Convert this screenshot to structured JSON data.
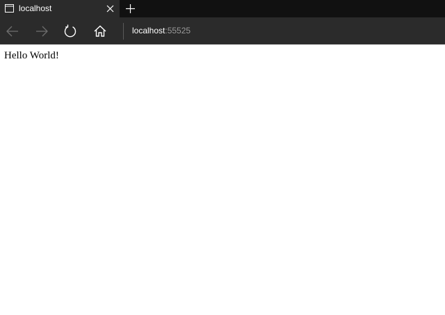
{
  "tab": {
    "title": "localhost",
    "icon": "page-icon"
  },
  "toolbar": {
    "back_icon": "back-arrow-icon",
    "forward_icon": "forward-arrow-icon",
    "refresh_icon": "refresh-icon",
    "home_icon": "home-icon",
    "new_tab_icon": "plus-icon",
    "close_tab_icon": "close-icon"
  },
  "address": {
    "host": "localhost",
    "port": ":55525"
  },
  "page": {
    "body_text": "Hello World!"
  },
  "colors": {
    "tabstrip": "#111111",
    "chrome": "#2b2b2b",
    "address_port": "#9a9a9a",
    "page_background": "#ffffff"
  }
}
